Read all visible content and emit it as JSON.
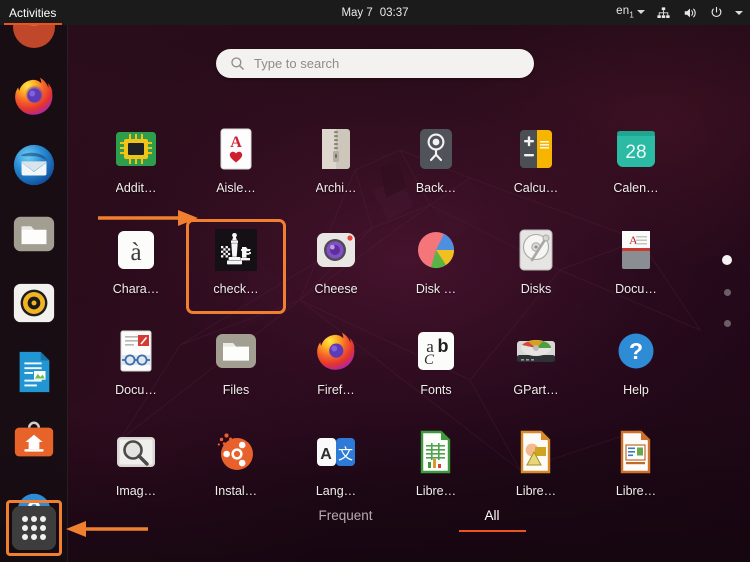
{
  "topbar": {
    "activities_label": "Activities",
    "clock": {
      "date": "May 7",
      "time": "03:37"
    },
    "keyboard_layout": "en",
    "keyboard_layout_index": "1",
    "icons": [
      "network-icon",
      "volume-icon",
      "power-icon",
      "chevron-down-icon"
    ]
  },
  "search": {
    "placeholder": "Type to search",
    "value": "",
    "icon": "search-icon"
  },
  "dock": {
    "items": [
      {
        "name": "dock-item-partial-top",
        "label": ""
      },
      {
        "name": "dock-item-firefox",
        "label": "Firefox"
      },
      {
        "name": "dock-item-thunderbird",
        "label": "Thunderbird"
      },
      {
        "name": "dock-item-files",
        "label": "Files"
      },
      {
        "name": "dock-item-rhythmbox",
        "label": "Rhythmbox"
      },
      {
        "name": "dock-item-libreoffice-writer",
        "label": "LibreOffice Writer"
      },
      {
        "name": "dock-item-ubuntu-software",
        "label": "Ubuntu Software"
      },
      {
        "name": "dock-item-help",
        "label": "Help"
      }
    ],
    "show_applications": {
      "label": "Show Applications",
      "icon": "grid-icon",
      "highlighted": true
    }
  },
  "apps": [
    {
      "label": "Addit…",
      "icon": "additional-drivers-icon",
      "selected": false
    },
    {
      "label": "Aisle…",
      "icon": "aisleriot-solitaire-icon",
      "selected": false
    },
    {
      "label": "Archi…",
      "icon": "archive-manager-icon",
      "selected": false
    },
    {
      "label": "Back…",
      "icon": "backups-icon",
      "selected": false
    },
    {
      "label": "Calcu…",
      "icon": "calculator-icon",
      "selected": false
    },
    {
      "label": "Calen…",
      "icon": "calendar-icon",
      "selected": false
    },
    {
      "label": "Chara…",
      "icon": "characters-icon",
      "selected": false
    },
    {
      "label": "check…",
      "icon": "chess-icon",
      "selected": true
    },
    {
      "label": "Cheese",
      "icon": "cheese-webcam-icon",
      "selected": false
    },
    {
      "label": "Disk …",
      "icon": "disk-usage-analyzer-icon",
      "selected": false
    },
    {
      "label": "Disks",
      "icon": "disks-icon",
      "selected": false
    },
    {
      "label": "Docu…",
      "icon": "document-viewer-icon",
      "selected": false
    },
    {
      "label": "Docu…",
      "icon": "document-scanner-icon",
      "selected": false
    },
    {
      "label": "Files",
      "icon": "files-icon",
      "selected": false
    },
    {
      "label": "Firef…",
      "icon": "firefox-icon",
      "selected": false
    },
    {
      "label": "Fonts",
      "icon": "fonts-icon",
      "selected": false
    },
    {
      "label": "GPart…",
      "icon": "gparted-icon",
      "selected": false
    },
    {
      "label": "Help",
      "icon": "help-icon",
      "selected": false
    },
    {
      "label": "Imag…",
      "icon": "image-viewer-icon",
      "selected": false
    },
    {
      "label": "Instal…",
      "icon": "install-ubuntu-icon",
      "selected": false
    },
    {
      "label": "Lang…",
      "icon": "language-support-icon",
      "selected": false
    },
    {
      "label": "Libre…",
      "icon": "libreoffice-calc-icon",
      "selected": false
    },
    {
      "label": "Libre…",
      "icon": "libreoffice-draw-icon",
      "selected": false
    },
    {
      "label": "Libre…",
      "icon": "libreoffice-impress-icon",
      "selected": false
    }
  ],
  "calendar_icon_day": "28",
  "page_dots": {
    "count": 3,
    "active_index": 0
  },
  "tabs": [
    {
      "label": "Frequent",
      "active": false
    },
    {
      "label": "All",
      "active": true
    }
  ],
  "annotations": [
    {
      "name": "arrow-to-chess-app",
      "direction": "right"
    },
    {
      "name": "arrow-to-show-applications",
      "direction": "left"
    }
  ],
  "colors": {
    "accent_orange": "#e95420",
    "annotation_orange": "#f08030",
    "topbar_bg": "#1b1b1b",
    "dock_bg": "#140e12",
    "search_bg": "#f4f2f1"
  }
}
